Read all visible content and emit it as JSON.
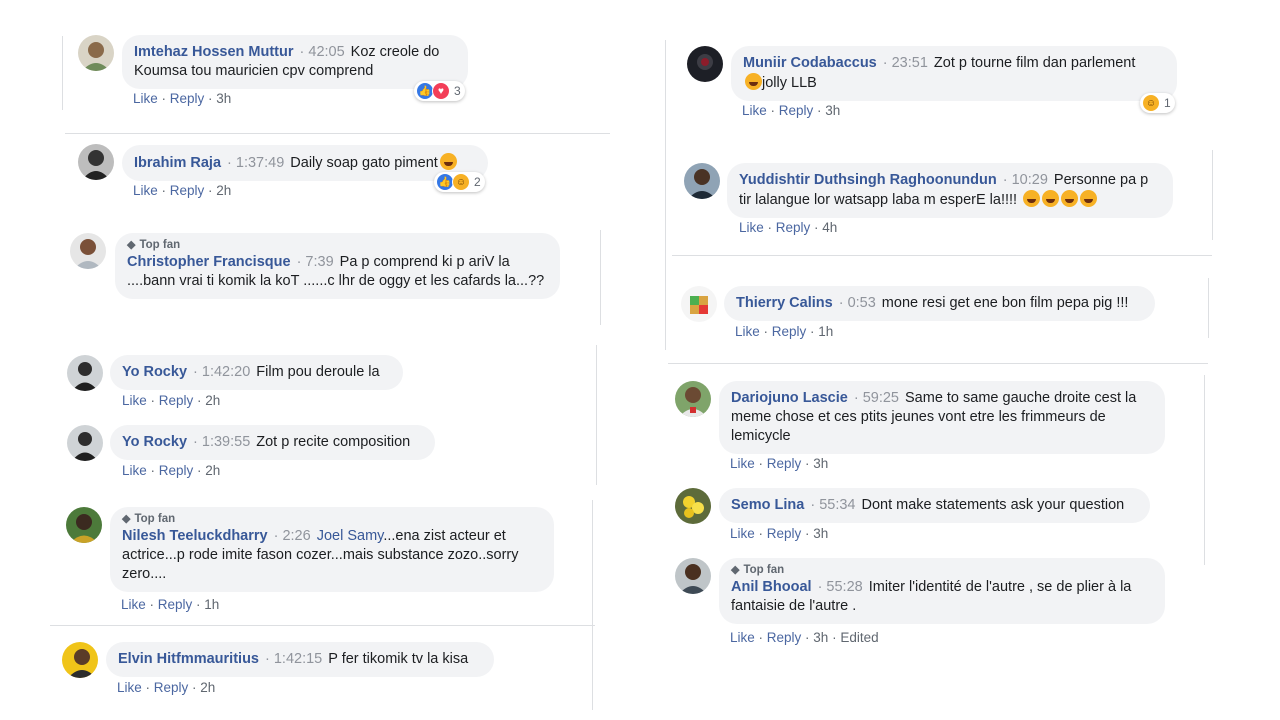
{
  "comments": [
    {
      "name": "Imtehaz Hossen Muttur",
      "time": "42:05",
      "text": "Koz creole do Koumsa tou mauricien cpv comprend",
      "like": "Like",
      "reply": "Reply",
      "age": "3h",
      "reactions": {
        "count": "3",
        "icons": [
          "like",
          "love"
        ]
      }
    },
    {
      "name": "Ibrahim Raja",
      "time": "1:37:49",
      "text": "Daily soap gato piment",
      "like": "Like",
      "reply": "Reply",
      "age": "2h",
      "reactions": {
        "count": "2",
        "icons": [
          "like",
          "haha"
        ]
      }
    },
    {
      "badge": "Top fan",
      "name": "Christopher Francisque",
      "time": "7:39",
      "text": "Pa p comprend ki p ariV la ....bann vrai ti komik la koT ......c lhr de oggy et les cafards la...??"
    },
    {
      "name": "Yo Rocky",
      "time": "1:42:20",
      "text": "Film pou deroule la",
      "like": "Like",
      "reply": "Reply",
      "age": "2h"
    },
    {
      "name": "Yo Rocky",
      "time": "1:39:55",
      "text": "Zot p recite composition",
      "like": "Like",
      "reply": "Reply",
      "age": "2h"
    },
    {
      "badge": "Top fan",
      "name": "Nilesh Teeluckdharry",
      "time": "2:26",
      "tag": "Joel Samy",
      "text": "...ena zist acteur et actrice...p rode imite fason cozer...mais substance zozo..sorry zero....",
      "like": "Like",
      "reply": "Reply",
      "age": "1h"
    },
    {
      "name": "Elvin Hitfmmauritius",
      "time": "1:42:15",
      "text": "P fer tikomik tv la kisa",
      "like": "Like",
      "reply": "Reply",
      "age": "2h"
    },
    {
      "name": "Muniir Codabaccus",
      "time": "23:51",
      "text": "Zot p tourne film dan parlement",
      "text2": "jolly LLB",
      "like": "Like",
      "reply": "Reply",
      "age": "3h",
      "reactions": {
        "count": "1",
        "icons": [
          "haha"
        ]
      }
    },
    {
      "name": "Yuddishtir Duthsingh Raghoonundun",
      "time": "10:29",
      "text": "Personne pa p tir lalangue lor watsapp laba m esperE la!!!!",
      "like": "Like",
      "reply": "Reply",
      "age": "4h"
    },
    {
      "name": "Thierry Calins",
      "time": "0:53",
      "text": "mone resi get ene bon film pepa pig !!!",
      "like": "Like",
      "reply": "Reply",
      "age": "1h"
    },
    {
      "name": "Dariojuno Lascie",
      "time": "59:25",
      "text": "Same to same gauche droite cest la meme chose et ces ptits jeunes vont etre les frimmeurs de lemicycle",
      "like": "Like",
      "reply": "Reply",
      "age": "3h"
    },
    {
      "name": "Semo Lina",
      "time": "55:34",
      "text": "Dont make statements ask your question",
      "like": "Like",
      "reply": "Reply",
      "age": "3h"
    },
    {
      "badge": "Top fan",
      "name": "Anil Bhooal",
      "time": "55:28",
      "text": "Imiter l'identité de l'autre , se de plier à la fantaisie de l'autre .",
      "like": "Like",
      "reply": "Reply",
      "age": "3h",
      "edited": "Edited"
    }
  ],
  "colors": {
    "name": "#385898",
    "bubble": "#f2f3f5",
    "timestamp": "#90949c",
    "actions": "#606770"
  }
}
